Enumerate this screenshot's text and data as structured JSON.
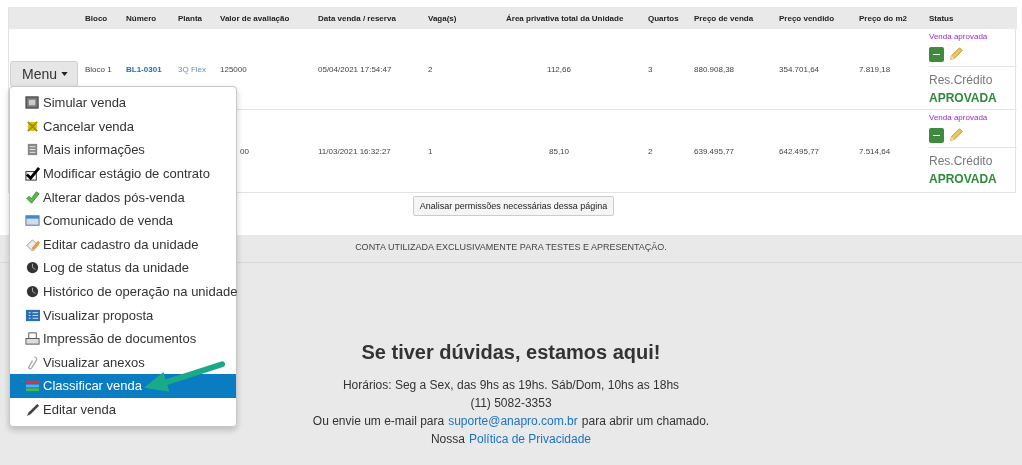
{
  "table": {
    "columns": [
      "",
      "Bloco",
      "Número",
      "Planta",
      "Valor de avaliação",
      "Data venda / reserva",
      "Vaga(s)",
      "Área privativa total da Unidade",
      "Quartos",
      "Preço de venda",
      "Preço vendido",
      "Preço do m2",
      "Status"
    ],
    "rows": [
      {
        "bloco": "Bloco 1",
        "numero": "BL1-0301",
        "planta": "3Q Flex",
        "valor": "125000",
        "data": "05/04/2021 17:54:47",
        "vagas": "2",
        "area": "112,66",
        "quartos": "3",
        "preco_venda": "880.908,38",
        "preco_vendido": "354.701,64",
        "preco_m2": "7.819,18",
        "status": "Venda aprovada",
        "credito_label": "Res.Crédito",
        "credito": "APROVADA"
      },
      {
        "valor": "00",
        "data": "11/03/2021 16:32:27",
        "vagas": "1",
        "area": "85,10",
        "quartos": "2",
        "preco_venda": "639.495,77",
        "preco_vendido": "642.495,77",
        "preco_m2": "7.514,64",
        "status": "Venda aprovada",
        "credito_label": "Res.Crédito",
        "credito": "APROVADA"
      }
    ]
  },
  "menu_button": {
    "label": "Menu"
  },
  "menu": {
    "items": [
      {
        "label": "Simular venda",
        "selected": false
      },
      {
        "label": "Cancelar venda",
        "selected": false
      },
      {
        "label": "Mais informações",
        "selected": false
      },
      {
        "label": "Modificar estágio de contrato",
        "selected": false
      },
      {
        "label": "Alterar dados pós-venda",
        "selected": false
      },
      {
        "label": "Comunicado de venda",
        "selected": false
      },
      {
        "label": "Editar cadastro da unidade",
        "selected": false
      },
      {
        "label": "Log de status da unidade",
        "selected": false
      },
      {
        "label": "Histórico de operação na unidade",
        "selected": false
      },
      {
        "label": "Visualizar proposta",
        "selected": false
      },
      {
        "label": "Impressão de documentos",
        "selected": false
      },
      {
        "label": "Visualizar anexos",
        "selected": false
      },
      {
        "label": "Classificar venda",
        "selected": true
      },
      {
        "label": "Editar venda",
        "selected": false
      }
    ]
  },
  "permissions_button": {
    "label": "Analisar permissões necessárias dessa página"
  },
  "footer": {
    "notice": "CONTA UTILIZADA EXCLUSIVAMENTE PARA TESTES E APRESENTAÇÃO.",
    "heading": "Se tiver dúvidas, estamos aqui!",
    "hours": "Horários: Seg a Sex, das 9hs as 19hs. Sáb/Dom, 10hs as 18hs",
    "phone": "(11) 5082-3353",
    "email_before": "Ou envie um e-mail para",
    "email": "suporte@anapro.com.br",
    "email_after": "para abrir um chamado.",
    "privacy_before": "Nossa",
    "privacy": "Política de Privacidade"
  }
}
